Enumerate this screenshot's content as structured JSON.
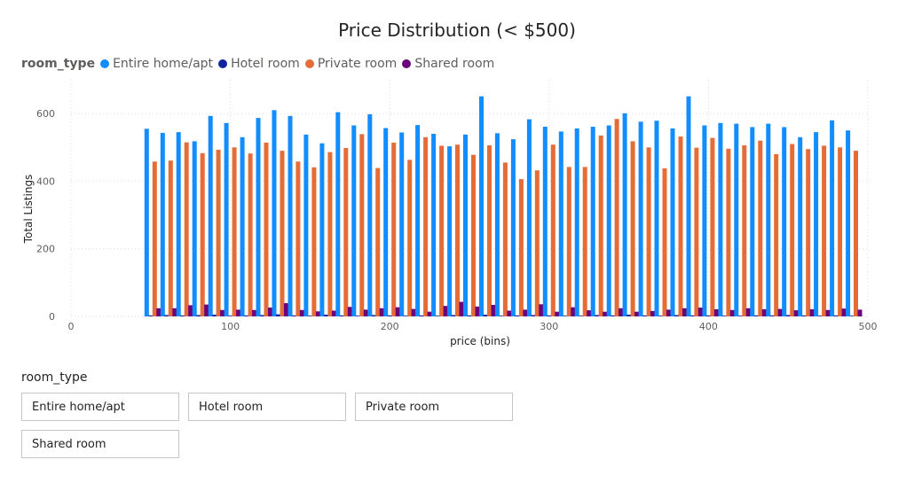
{
  "chart_data": {
    "type": "bar",
    "title": "Price Distribution (< $500)",
    "xlabel": "price (bins)",
    "ylabel": "Total Listings",
    "xlim": [
      0,
      500
    ],
    "ylim": [
      0,
      700
    ],
    "x_ticks": [
      0,
      100,
      200,
      300,
      400,
      500
    ],
    "y_ticks": [
      0,
      200,
      400,
      600
    ],
    "grid": true,
    "legend_title": "room_type",
    "legend_position": "top-left",
    "bin_width": 10,
    "x": [
      50,
      60,
      70,
      80,
      90,
      100,
      110,
      120,
      130,
      140,
      150,
      160,
      170,
      180,
      190,
      200,
      210,
      220,
      230,
      240,
      250,
      260,
      270,
      280,
      290,
      300,
      310,
      320,
      330,
      340,
      350,
      360,
      370,
      380,
      390,
      400,
      410,
      420,
      430,
      440,
      450,
      460,
      470,
      480,
      490
    ],
    "series": [
      {
        "name": "Entire home/apt",
        "color": "#118dff",
        "values": [
          555,
          543,
          545,
          518,
          593,
          572,
          530,
          587,
          610,
          593,
          538,
          512,
          604,
          565,
          598,
          557,
          544,
          566,
          540,
          503,
          538,
          651,
          542,
          524,
          583,
          561,
          547,
          556,
          561,
          565,
          601,
          576,
          579,
          556,
          651,
          565,
          572,
          570,
          560,
          570,
          560,
          530,
          545,
          580,
          550
        ]
      },
      {
        "name": "Hotel room",
        "color": "#12239e",
        "values": [
          3,
          4,
          3,
          4,
          5,
          2,
          3,
          4,
          6,
          3,
          2,
          5,
          3,
          2,
          4,
          3,
          2,
          3,
          2,
          4,
          3,
          5,
          2,
          3,
          4,
          3,
          2,
          2,
          4,
          3,
          5,
          3,
          2,
          4,
          3,
          3,
          2,
          2,
          3,
          3,
          4,
          3,
          2,
          3,
          2
        ]
      },
      {
        "name": "Private room",
        "color": "#e66c37",
        "values": [
          458,
          461,
          515,
          483,
          493,
          500,
          482,
          514,
          490,
          458,
          441,
          486,
          498,
          539,
          439,
          514,
          463,
          530,
          505,
          508,
          478,
          506,
          455,
          406,
          432,
          508,
          442,
          442,
          535,
          584,
          518,
          500,
          438,
          532,
          499,
          528,
          496,
          506,
          520,
          480,
          510,
          495,
          505,
          500,
          490
        ]
      },
      {
        "name": "Shared room",
        "color": "#6b007b",
        "values": [
          24,
          24,
          33,
          35,
          19,
          20,
          19,
          26,
          39,
          19,
          15,
          17,
          28,
          20,
          24,
          27,
          22,
          14,
          31,
          43,
          29,
          34,
          17,
          20,
          36,
          14,
          27,
          18,
          14,
          24,
          14,
          16,
          20,
          24,
          26,
          21,
          19,
          24,
          21,
          22,
          18,
          21,
          19,
          23,
          20
        ]
      }
    ]
  },
  "slicer": {
    "title": "room_type",
    "options": [
      "Entire home/apt",
      "Hotel room",
      "Private room",
      "Shared room"
    ]
  }
}
